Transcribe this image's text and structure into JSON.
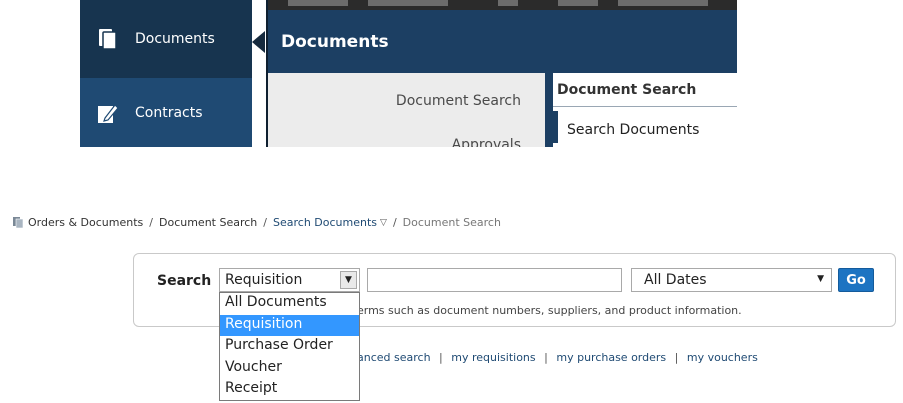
{
  "nav": {
    "sidebar_items": [
      {
        "label": "Documents",
        "icon": "documents-icon"
      },
      {
        "label": "Contracts",
        "icon": "contracts-icon"
      }
    ],
    "flyout": {
      "title": "Documents",
      "left_links": [
        "Document Search",
        "Approvals"
      ],
      "section_title": "Document Search",
      "section_items": [
        "Search Documents"
      ]
    }
  },
  "breadcrumb": {
    "items": [
      "Orders & Documents",
      "Document Search",
      "Search Documents",
      "Document Search"
    ]
  },
  "search": {
    "label": "Search",
    "type_value": "Requisition",
    "query_value": "",
    "date_value": "All Dates",
    "go_label": "Go",
    "hint": "erms such as document numbers, suppliers, and product information.",
    "links": [
      "anced search",
      "my requisitions",
      "my purchase orders",
      "my vouchers"
    ],
    "dropdown_options": [
      "All Documents",
      "Requisition",
      "Purchase Order",
      "Voucher",
      "Receipt"
    ],
    "dropdown_selected": "Requisition"
  },
  "colors": {
    "nav_bg": "#1c3f63",
    "accent": "#1d74c2",
    "highlight": "#3397ff"
  }
}
